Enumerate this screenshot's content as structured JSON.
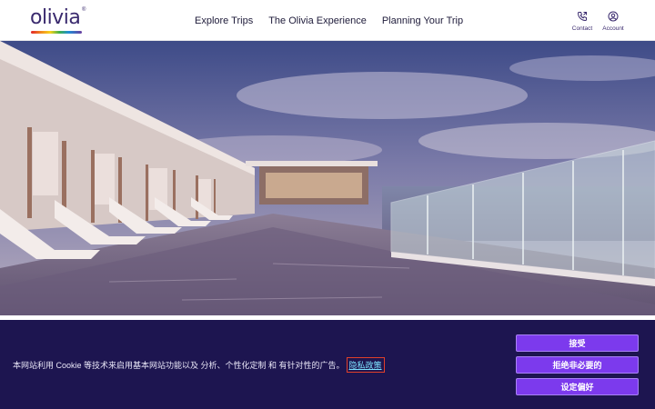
{
  "brand": {
    "name": "olivia",
    "registered": "®"
  },
  "nav": {
    "items": [
      {
        "label": "Explore Trips"
      },
      {
        "label": "The Olivia Experience"
      },
      {
        "label": "Planning Your Trip"
      }
    ]
  },
  "utility": {
    "contact": {
      "label": "Contact",
      "icon": "phone-icon"
    },
    "account": {
      "label": "Account",
      "icon": "user-circle-icon"
    }
  },
  "hero": {
    "image": "rooftop infinity pool with cabanas and ocean view"
  },
  "cookie_banner": {
    "message": "本网站利用 Cookie 等技术来启用基本网站功能以及 分析、个性化定制 和 有针对性的广告。",
    "privacy_link": "隐私政策",
    "accept_label": "接受",
    "reject_label": "拒绝非必要的",
    "prefs_label": "设定偏好"
  },
  "colors": {
    "brand": "#3a2a6e",
    "banner_bg": "#1d1550",
    "button": "#7c3aed",
    "link": "#7ee2ff"
  }
}
